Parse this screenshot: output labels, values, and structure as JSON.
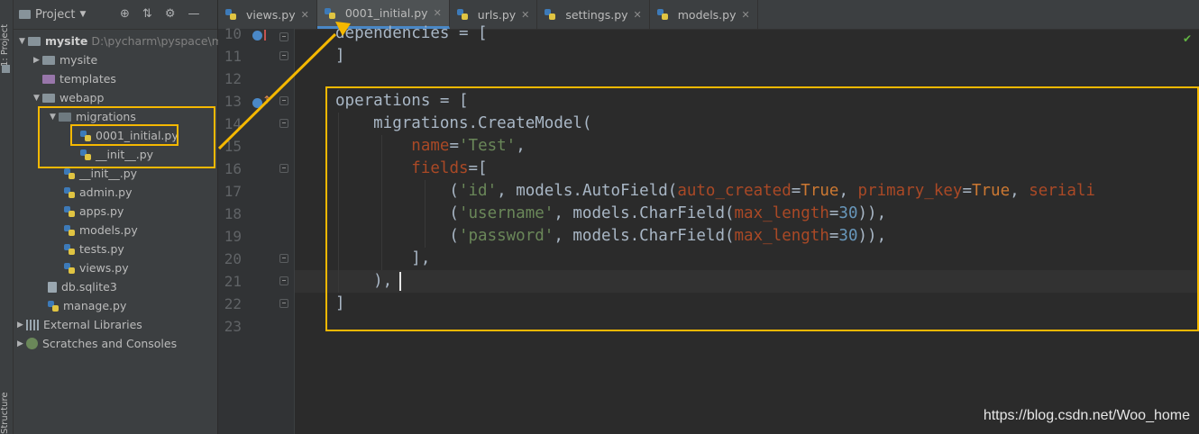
{
  "left_strip": {
    "project_label": "1: Project",
    "structure_label": "Structure"
  },
  "project_panel": {
    "title": "Project",
    "tree": [
      {
        "label": "mysite",
        "extra": "D:\\pycharm\\pyspace\\my"
      },
      {
        "label": "mysite"
      },
      {
        "label": "templates"
      },
      {
        "label": "webapp"
      },
      {
        "label": "migrations"
      },
      {
        "label": "0001_initial.py"
      },
      {
        "label": "__init__.py"
      },
      {
        "label": "__init__.py"
      },
      {
        "label": "admin.py"
      },
      {
        "label": "apps.py"
      },
      {
        "label": "models.py"
      },
      {
        "label": "tests.py"
      },
      {
        "label": "views.py"
      },
      {
        "label": "db.sqlite3"
      },
      {
        "label": "manage.py"
      },
      {
        "label": "External Libraries"
      },
      {
        "label": "Scratches and Consoles"
      }
    ]
  },
  "tabs": [
    {
      "label": "views.py"
    },
    {
      "label": "0001_initial.py",
      "active": true
    },
    {
      "label": "urls.py"
    },
    {
      "label": "settings.py"
    },
    {
      "label": "models.py"
    }
  ],
  "editor": {
    "line_numbers": [
      "10",
      "11",
      "12",
      "13",
      "14",
      "15",
      "16",
      "17",
      "18",
      "19",
      "20",
      "21",
      "22",
      "23"
    ]
  },
  "watermark": "https://blog.csdn.net/Woo_home",
  "colors": {
    "highlight": "#f5b800",
    "active_tab_underline": "#4a88c7"
  }
}
